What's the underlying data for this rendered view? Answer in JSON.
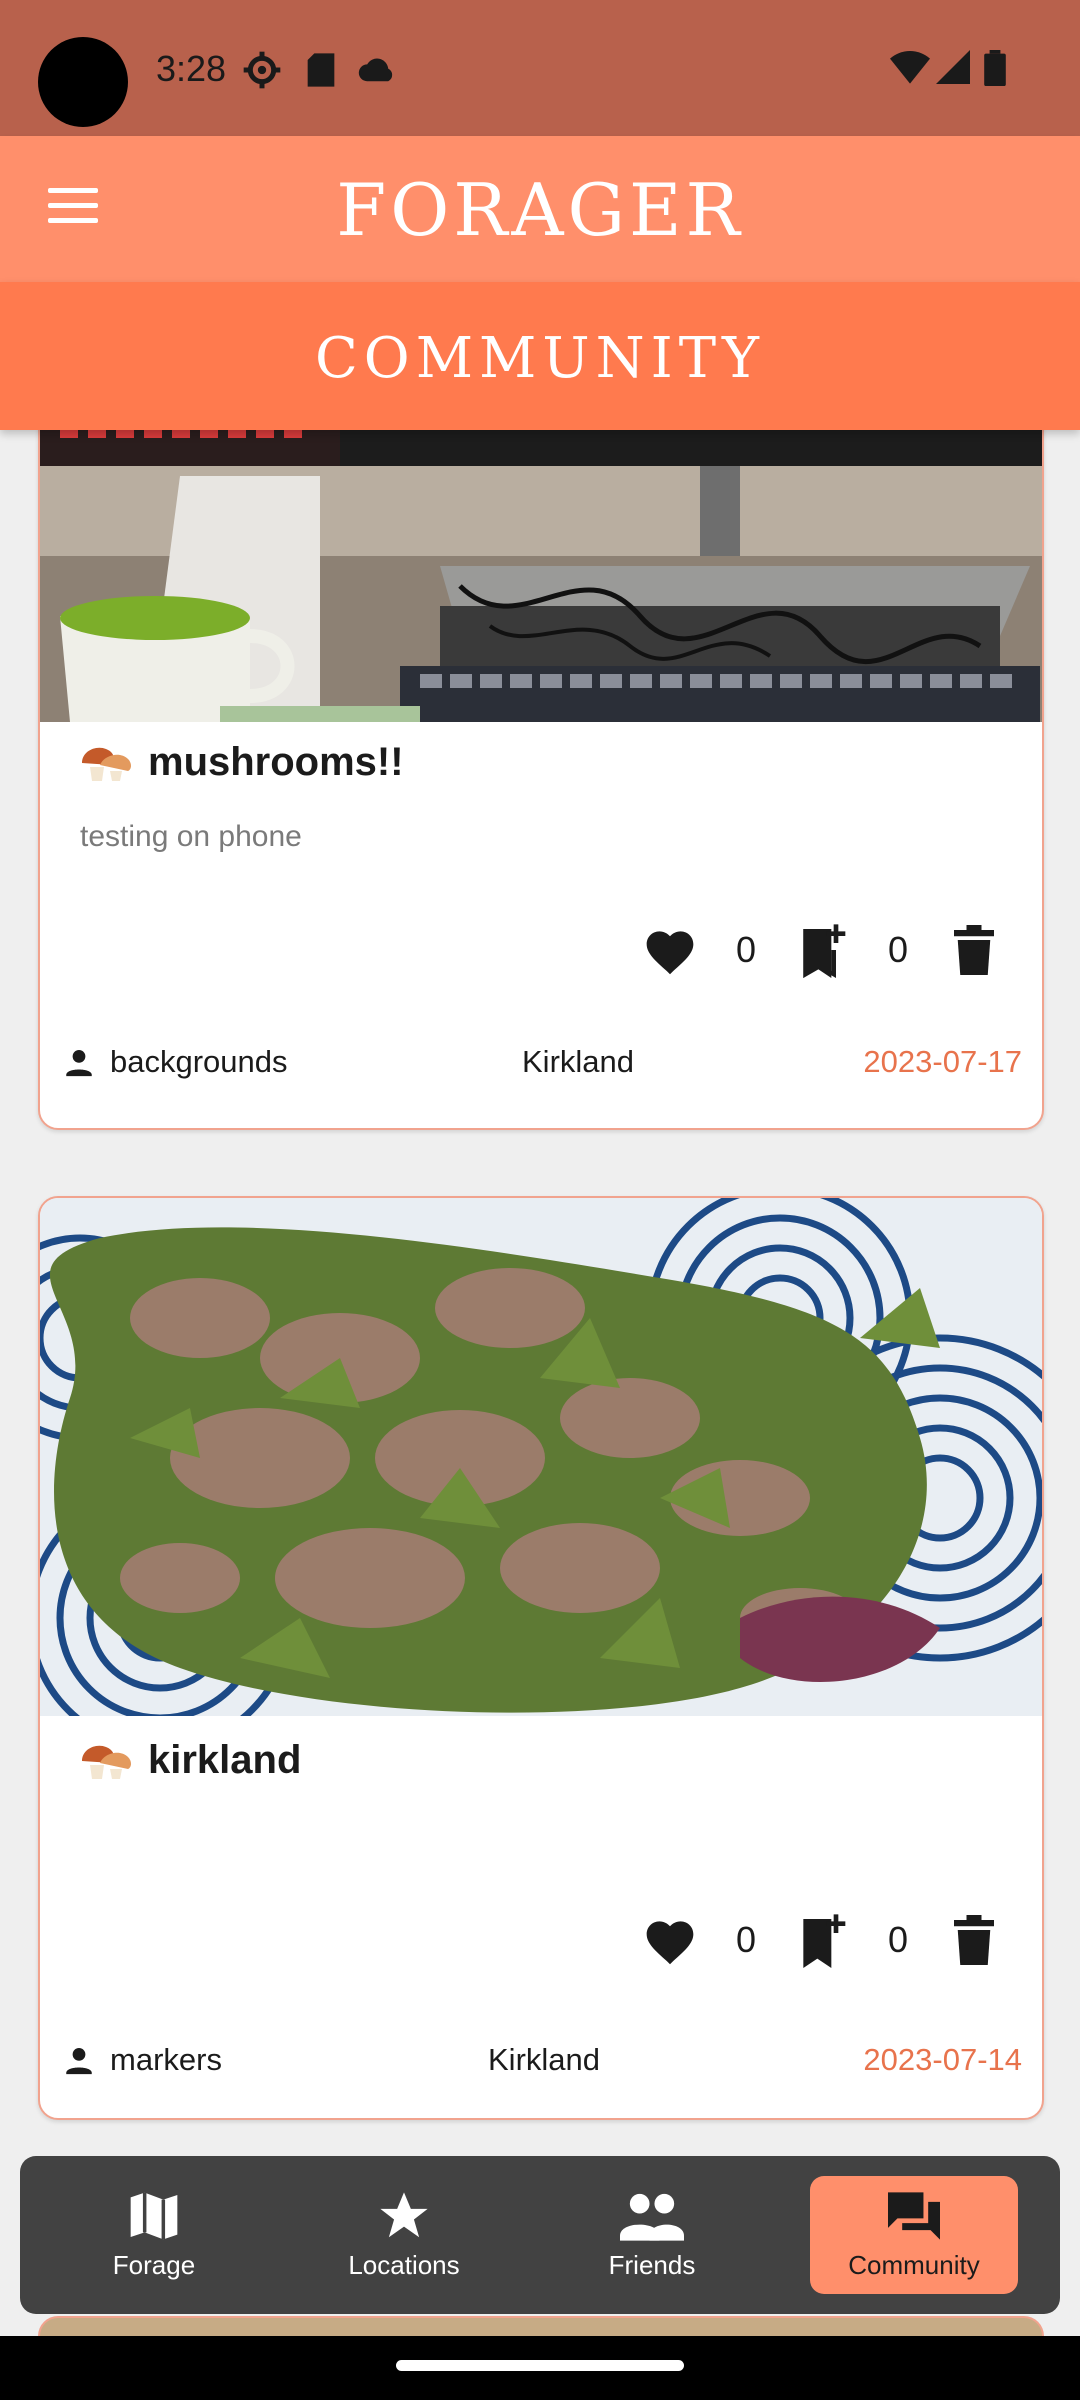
{
  "status_bar": {
    "time": "3:28"
  },
  "app_bar": {
    "title": "FORAGER"
  },
  "section": {
    "title": "COMMUNITY"
  },
  "posts": [
    {
      "title": "mushrooms!!",
      "description": "testing on phone",
      "likes": "0",
      "saves": "0",
      "user": "backgrounds",
      "location": "Kirkland",
      "date": "2023-07-17"
    },
    {
      "title": "kirkland",
      "description": "",
      "likes": "0",
      "saves": "0",
      "user": "markers",
      "location": "Kirkland",
      "date": "2023-07-14"
    }
  ],
  "bottom_nav": {
    "items": [
      {
        "label": "Forage",
        "icon": "map-icon"
      },
      {
        "label": "Locations",
        "icon": "star-icon"
      },
      {
        "label": "Friends",
        "icon": "people-icon"
      },
      {
        "label": "Community",
        "icon": "forum-icon",
        "active": true
      }
    ]
  },
  "colors": {
    "status_bar": "#b8614c",
    "app_bar": "#ff8f6b",
    "section_bar": "#ff7a4e",
    "date_accent": "#e8734c",
    "nav_background": "#424242"
  }
}
